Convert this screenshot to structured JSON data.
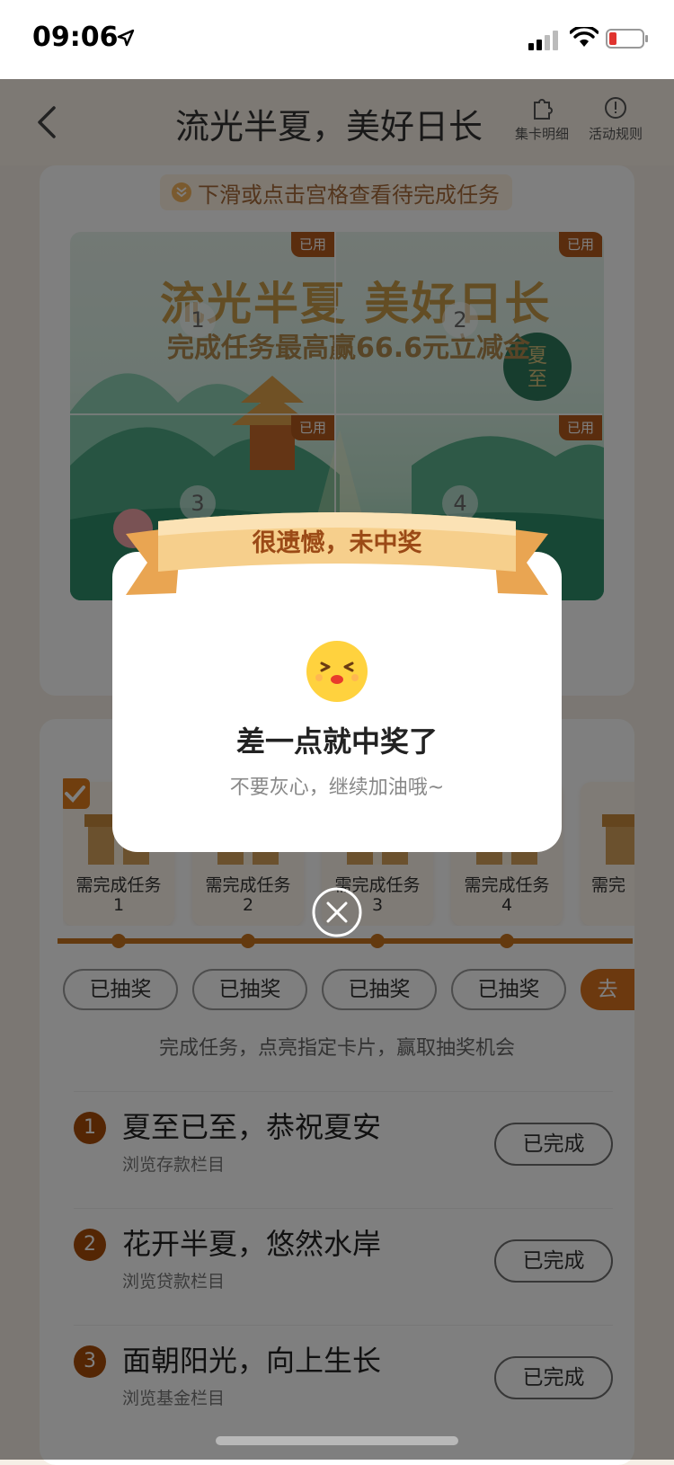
{
  "status_bar": {
    "time": "09:06",
    "icons": [
      "location-arrow-icon",
      "signal-icon",
      "wifi-icon",
      "battery-low-icon"
    ]
  },
  "nav": {
    "title": "流光半夏，美好日长",
    "actions": [
      {
        "label": "集卡明细",
        "icon": "puzzle-icon"
      },
      {
        "label": "活动规则",
        "icon": "info-icon"
      }
    ]
  },
  "hint": "下滑或点击宫格查看待完成任务",
  "puzzle": {
    "title": "流光半夏 美好日长",
    "subtitle": "完成任务最高赢66.6元立减金",
    "badge": "夏至",
    "cells": [
      {
        "number": "1",
        "tag": "已用"
      },
      {
        "number": "2",
        "tag": "已用"
      },
      {
        "number": "3",
        "tag": "已用"
      },
      {
        "number": "4",
        "tag": "已用"
      }
    ]
  },
  "rewards": [
    {
      "label": "需完成任务",
      "count": "1"
    },
    {
      "label": "需完成任务",
      "count": "2"
    },
    {
      "label": "需完成任务",
      "count": "3"
    },
    {
      "label": "需完成任务",
      "count": "4"
    },
    {
      "label": "需完",
      "count": ""
    }
  ],
  "draw_buttons": [
    "已抽奖",
    "已抽奖",
    "已抽奖",
    "已抽奖",
    "去"
  ],
  "lottery_subline": "完成任务，点亮指定卡片，赢取抽奖机会",
  "tasks": [
    {
      "num": "1",
      "title": "夏至已至，恭祝夏安",
      "sub": "浏览存款栏目",
      "button": "已完成"
    },
    {
      "num": "2",
      "title": "花开半夏，悠然水岸",
      "sub": "浏览贷款栏目",
      "button": "已完成"
    },
    {
      "num": "3",
      "title": "面朝阳光，向上生长",
      "sub": "浏览基金栏目",
      "button": "已完成"
    }
  ],
  "modal": {
    "ribbon": "很遗憾，未中奖",
    "title": "差一点就中奖了",
    "subtitle": "不要灰心，继续加油哦~"
  },
  "colors": {
    "accent": "#d8731e",
    "ribbon": "#f2c27a",
    "ribbon_text": "#9b4a16",
    "task_num": "#a94c08"
  }
}
